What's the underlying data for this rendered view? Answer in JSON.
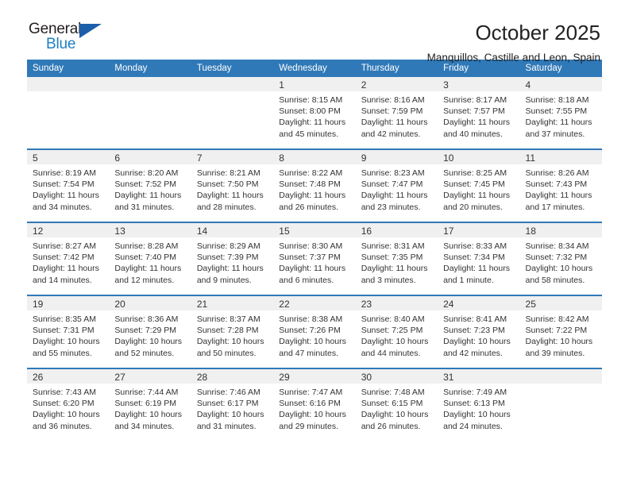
{
  "brand": {
    "name_part1": "General",
    "name_part2": "Blue",
    "accent_color": "#1d7fc4",
    "triangle_color": "#1b5faa"
  },
  "header": {
    "title": "October 2025",
    "subtitle": "Manquillos, Castille and Leon, Spain"
  },
  "calendar": {
    "header_bg": "#3079b8",
    "daynum_bg": "#f0f0f0",
    "weekday_headers": [
      "Sunday",
      "Monday",
      "Tuesday",
      "Wednesday",
      "Thursday",
      "Friday",
      "Saturday"
    ],
    "weeks": [
      [
        {
          "day": "",
          "empty": true
        },
        {
          "day": "",
          "empty": true
        },
        {
          "day": "",
          "empty": true
        },
        {
          "day": "1",
          "sunrise": "Sunrise: 8:15 AM",
          "sunset": "Sunset: 8:00 PM",
          "daylight1": "Daylight: 11 hours",
          "daylight2": "and 45 minutes."
        },
        {
          "day": "2",
          "sunrise": "Sunrise: 8:16 AM",
          "sunset": "Sunset: 7:59 PM",
          "daylight1": "Daylight: 11 hours",
          "daylight2": "and 42 minutes."
        },
        {
          "day": "3",
          "sunrise": "Sunrise: 8:17 AM",
          "sunset": "Sunset: 7:57 PM",
          "daylight1": "Daylight: 11 hours",
          "daylight2": "and 40 minutes."
        },
        {
          "day": "4",
          "sunrise": "Sunrise: 8:18 AM",
          "sunset": "Sunset: 7:55 PM",
          "daylight1": "Daylight: 11 hours",
          "daylight2": "and 37 minutes."
        }
      ],
      [
        {
          "day": "5",
          "sunrise": "Sunrise: 8:19 AM",
          "sunset": "Sunset: 7:54 PM",
          "daylight1": "Daylight: 11 hours",
          "daylight2": "and 34 minutes."
        },
        {
          "day": "6",
          "sunrise": "Sunrise: 8:20 AM",
          "sunset": "Sunset: 7:52 PM",
          "daylight1": "Daylight: 11 hours",
          "daylight2": "and 31 minutes."
        },
        {
          "day": "7",
          "sunrise": "Sunrise: 8:21 AM",
          "sunset": "Sunset: 7:50 PM",
          "daylight1": "Daylight: 11 hours",
          "daylight2": "and 28 minutes."
        },
        {
          "day": "8",
          "sunrise": "Sunrise: 8:22 AM",
          "sunset": "Sunset: 7:48 PM",
          "daylight1": "Daylight: 11 hours",
          "daylight2": "and 26 minutes."
        },
        {
          "day": "9",
          "sunrise": "Sunrise: 8:23 AM",
          "sunset": "Sunset: 7:47 PM",
          "daylight1": "Daylight: 11 hours",
          "daylight2": "and 23 minutes."
        },
        {
          "day": "10",
          "sunrise": "Sunrise: 8:25 AM",
          "sunset": "Sunset: 7:45 PM",
          "daylight1": "Daylight: 11 hours",
          "daylight2": "and 20 minutes."
        },
        {
          "day": "11",
          "sunrise": "Sunrise: 8:26 AM",
          "sunset": "Sunset: 7:43 PM",
          "daylight1": "Daylight: 11 hours",
          "daylight2": "and 17 minutes."
        }
      ],
      [
        {
          "day": "12",
          "sunrise": "Sunrise: 8:27 AM",
          "sunset": "Sunset: 7:42 PM",
          "daylight1": "Daylight: 11 hours",
          "daylight2": "and 14 minutes."
        },
        {
          "day": "13",
          "sunrise": "Sunrise: 8:28 AM",
          "sunset": "Sunset: 7:40 PM",
          "daylight1": "Daylight: 11 hours",
          "daylight2": "and 12 minutes."
        },
        {
          "day": "14",
          "sunrise": "Sunrise: 8:29 AM",
          "sunset": "Sunset: 7:39 PM",
          "daylight1": "Daylight: 11 hours",
          "daylight2": "and 9 minutes."
        },
        {
          "day": "15",
          "sunrise": "Sunrise: 8:30 AM",
          "sunset": "Sunset: 7:37 PM",
          "daylight1": "Daylight: 11 hours",
          "daylight2": "and 6 minutes."
        },
        {
          "day": "16",
          "sunrise": "Sunrise: 8:31 AM",
          "sunset": "Sunset: 7:35 PM",
          "daylight1": "Daylight: 11 hours",
          "daylight2": "and 3 minutes."
        },
        {
          "day": "17",
          "sunrise": "Sunrise: 8:33 AM",
          "sunset": "Sunset: 7:34 PM",
          "daylight1": "Daylight: 11 hours",
          "daylight2": "and 1 minute."
        },
        {
          "day": "18",
          "sunrise": "Sunrise: 8:34 AM",
          "sunset": "Sunset: 7:32 PM",
          "daylight1": "Daylight: 10 hours",
          "daylight2": "and 58 minutes."
        }
      ],
      [
        {
          "day": "19",
          "sunrise": "Sunrise: 8:35 AM",
          "sunset": "Sunset: 7:31 PM",
          "daylight1": "Daylight: 10 hours",
          "daylight2": "and 55 minutes."
        },
        {
          "day": "20",
          "sunrise": "Sunrise: 8:36 AM",
          "sunset": "Sunset: 7:29 PM",
          "daylight1": "Daylight: 10 hours",
          "daylight2": "and 52 minutes."
        },
        {
          "day": "21",
          "sunrise": "Sunrise: 8:37 AM",
          "sunset": "Sunset: 7:28 PM",
          "daylight1": "Daylight: 10 hours",
          "daylight2": "and 50 minutes."
        },
        {
          "day": "22",
          "sunrise": "Sunrise: 8:38 AM",
          "sunset": "Sunset: 7:26 PM",
          "daylight1": "Daylight: 10 hours",
          "daylight2": "and 47 minutes."
        },
        {
          "day": "23",
          "sunrise": "Sunrise: 8:40 AM",
          "sunset": "Sunset: 7:25 PM",
          "daylight1": "Daylight: 10 hours",
          "daylight2": "and 44 minutes."
        },
        {
          "day": "24",
          "sunrise": "Sunrise: 8:41 AM",
          "sunset": "Sunset: 7:23 PM",
          "daylight1": "Daylight: 10 hours",
          "daylight2": "and 42 minutes."
        },
        {
          "day": "25",
          "sunrise": "Sunrise: 8:42 AM",
          "sunset": "Sunset: 7:22 PM",
          "daylight1": "Daylight: 10 hours",
          "daylight2": "and 39 minutes."
        }
      ],
      [
        {
          "day": "26",
          "sunrise": "Sunrise: 7:43 AM",
          "sunset": "Sunset: 6:20 PM",
          "daylight1": "Daylight: 10 hours",
          "daylight2": "and 36 minutes."
        },
        {
          "day": "27",
          "sunrise": "Sunrise: 7:44 AM",
          "sunset": "Sunset: 6:19 PM",
          "daylight1": "Daylight: 10 hours",
          "daylight2": "and 34 minutes."
        },
        {
          "day": "28",
          "sunrise": "Sunrise: 7:46 AM",
          "sunset": "Sunset: 6:17 PM",
          "daylight1": "Daylight: 10 hours",
          "daylight2": "and 31 minutes."
        },
        {
          "day": "29",
          "sunrise": "Sunrise: 7:47 AM",
          "sunset": "Sunset: 6:16 PM",
          "daylight1": "Daylight: 10 hours",
          "daylight2": "and 29 minutes."
        },
        {
          "day": "30",
          "sunrise": "Sunrise: 7:48 AM",
          "sunset": "Sunset: 6:15 PM",
          "daylight1": "Daylight: 10 hours",
          "daylight2": "and 26 minutes."
        },
        {
          "day": "31",
          "sunrise": "Sunrise: 7:49 AM",
          "sunset": "Sunset: 6:13 PM",
          "daylight1": "Daylight: 10 hours",
          "daylight2": "and 24 minutes."
        },
        {
          "day": "",
          "empty": true
        }
      ]
    ]
  }
}
